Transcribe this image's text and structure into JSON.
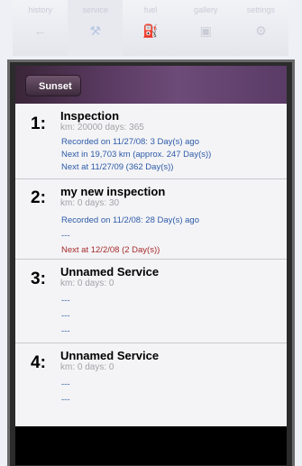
{
  "tabbar": {
    "tabs": [
      {
        "label": "history",
        "icon": "back-icon"
      },
      {
        "label": "service",
        "icon": "wrench-icon"
      },
      {
        "label": "fuel",
        "icon": "pump-icon"
      },
      {
        "label": "gallery",
        "icon": "camera-icon"
      },
      {
        "label": "settings",
        "icon": "gear-icon"
      }
    ]
  },
  "navbar": {
    "back_label": "Sunset"
  },
  "items": [
    {
      "number": "1:",
      "title": "Inspection",
      "sub": "km: 20000   days: 365",
      "lines": [
        "Recorded on 11/27/08: 3 Day(s) ago",
        "Next in 19,703 km (approx. 247 Day(s))",
        "Next at 11/27/09 (362 Day(s))"
      ]
    },
    {
      "number": "2:",
      "title": "my new inspection",
      "sub": "km: 0   days: 30",
      "lines": [
        "Recorded on 11/2/08: 28 Day(s) ago",
        "---",
        "Next at 12/2/08 (2 Day(s))"
      ]
    },
    {
      "number": "3:",
      "title": "Unnamed Service",
      "sub": "km: 0   days: 0",
      "lines": [
        "---",
        "---",
        "---"
      ]
    },
    {
      "number": "4:",
      "title": "Unnamed Service",
      "sub": "km: 0   days: 0",
      "lines": [
        "---",
        "---"
      ]
    }
  ]
}
